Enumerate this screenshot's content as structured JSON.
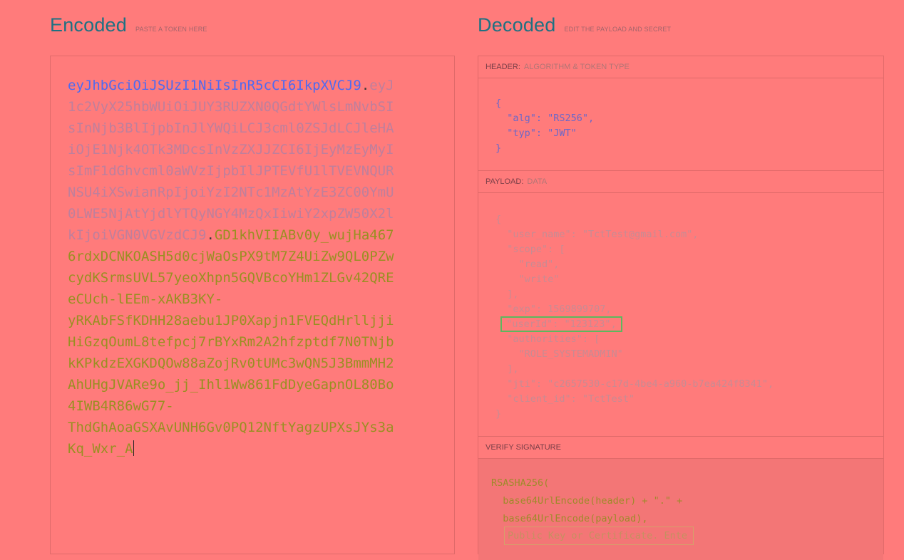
{
  "encoded": {
    "title": "Encoded",
    "subtitle": "PASTE A TOKEN HERE",
    "token_lines": [
      [
        {
          "part": "header",
          "text": "eyJhbGciOiJSUzI1NiIsInR5cCI6IkpXVCJ9"
        },
        {
          "part": "dot",
          "text": "."
        },
        {
          "part": "payload",
          "text": "eyJ"
        }
      ],
      [
        {
          "part": "payload",
          "text": "1c2VyX25hbWUiOiJUY3RUZXN0QGdtYWlsLmNvbSI"
        }
      ],
      [
        {
          "part": "payload",
          "text": "sInNjb3BlIjpbInJlYWQiLCJ3cml0ZSJdLCJleHA"
        }
      ],
      [
        {
          "part": "payload",
          "text": "iOjE1Njk4OTk3MDcsInVzZXJJZCI6IjEyMzEyMyI"
        }
      ],
      [
        {
          "part": "payload",
          "text": "sImF1dGhvcml0aWVzIjpbIlJPTEVfU1lTVEVNQUR"
        }
      ],
      [
        {
          "part": "payload",
          "text": "NSU4iXSwianRpIjoiYzI2NTc1MzAtYzE3ZC00YmU"
        }
      ],
      [
        {
          "part": "payload",
          "text": "0LWE5NjAtYjdlYTQyNGY4MzQxIiwiY2xpZW50X2l"
        }
      ],
      [
        {
          "part": "payload",
          "text": "kIjoiVGN0VGVzdCJ9"
        },
        {
          "part": "dot",
          "text": "."
        },
        {
          "part": "sig",
          "text": "GD1khVIIABv0y_wujHa467"
        }
      ],
      [
        {
          "part": "sig",
          "text": "6rdxDCNKOASH5d0cjWaOsPX9tM7Z4UiZw9QL0PZw"
        }
      ],
      [
        {
          "part": "sig",
          "text": "cydKSrmsUVL57yeoXhpn5GQVBcoYHm1ZLGv42QRE"
        }
      ],
      [
        {
          "part": "sig",
          "text": "eCUch-lEEm-xAKB3KY-"
        }
      ],
      [
        {
          "part": "sig",
          "text": "yRKAbFSfKDHH28aebu1JP0Xapjn1FVEQdHrlljji"
        }
      ],
      [
        {
          "part": "sig",
          "text": "HiGzqOumL8tefpcj7rBYxRm2A2hfzptdf7N0TNjb"
        }
      ],
      [
        {
          "part": "sig",
          "text": "kKPkdzEXGKDQOw88aZojRv0tUMc3wQN5J3BmmMH2"
        }
      ],
      [
        {
          "part": "sig",
          "text": "AhUHgJVARe9o_jj_Ihl1Ww861FdDyeGapnOL80Bo"
        }
      ],
      [
        {
          "part": "sig",
          "text": "4IWB4R86wG77-"
        }
      ],
      [
        {
          "part": "sig",
          "text": "ThdGhAoaGSXAvUNH6Gv0PQ12NftYagzUPXsJYs3a"
        }
      ],
      [
        {
          "part": "sig",
          "text": "Kq_Wxr_A"
        }
      ]
    ]
  },
  "decoded": {
    "title": "Decoded",
    "subtitle": "EDIT THE PAYLOAD AND SECRET",
    "header_section": {
      "label": "HEADER:",
      "sublabel": "ALGORITHM & TOKEN TYPE",
      "lines": [
        "{",
        "  \"alg\": \"RS256\",",
        "  \"typ\": \"JWT\"",
        "}"
      ]
    },
    "payload_section": {
      "label": "PAYLOAD:",
      "sublabel": "DATA",
      "lines": [
        "{",
        "  \"user_name\": \"TctTest@gmail.com\",",
        "  \"scope\": [",
        "    \"read\",",
        "    \"write\"",
        "  ],",
        "  \"exp\": 1569899707,",
        "  \"userId\": \"123123\",",
        "  \"authorities\": [",
        "    \"ROLE_SYSTEMADMIN\"",
        "  ],",
        "  \"jti\": \"c2657530-c17d-4be4-a960-b7ea424f8341\",",
        "  \"client_id\": \"TctTest\"",
        "}"
      ],
      "highlighted_line": 7
    },
    "signature_section": {
      "label": "VERIFY SIGNATURE",
      "lines": [
        "RSASHA256(",
        "  base64UrlEncode(header) + \".\" +",
        "  base64UrlEncode(payload),"
      ],
      "public_key_placeholder": "Public Key or Certificate. Ente"
    }
  }
}
